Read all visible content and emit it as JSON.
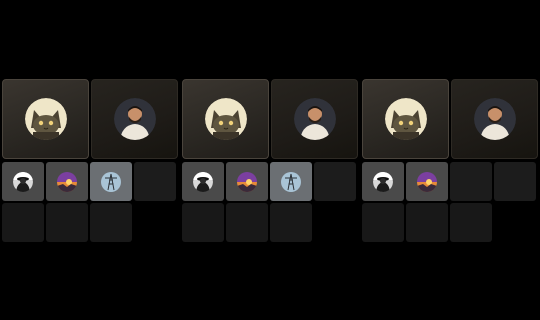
{
  "panels": [
    {
      "id": "a",
      "featured": [
        "cat-avatar",
        "man-avatar"
      ],
      "tiles": [
        "icon-person-hat",
        "icon-sunset",
        "icon-pylon",
        "empty",
        "empty",
        "empty",
        "empty"
      ]
    },
    {
      "id": "b",
      "featured": [
        "cat-avatar",
        "man-avatar"
      ],
      "tiles": [
        "icon-person-hat",
        "icon-sunset",
        "icon-pylon",
        "empty",
        "empty",
        "empty",
        "empty"
      ]
    },
    {
      "id": "c",
      "featured": [
        "cat-avatar",
        "man-avatar"
      ],
      "tiles": [
        "icon-person-hat",
        "icon-sunset",
        "empty",
        "empty",
        "empty",
        "empty",
        "empty"
      ]
    }
  ],
  "colors": {
    "background": "#000000",
    "card_left": "#2b2823",
    "card_right": "#1e1b17",
    "tile_filled": "#4a4a4a",
    "tile_empty": "#1c1c1c"
  }
}
